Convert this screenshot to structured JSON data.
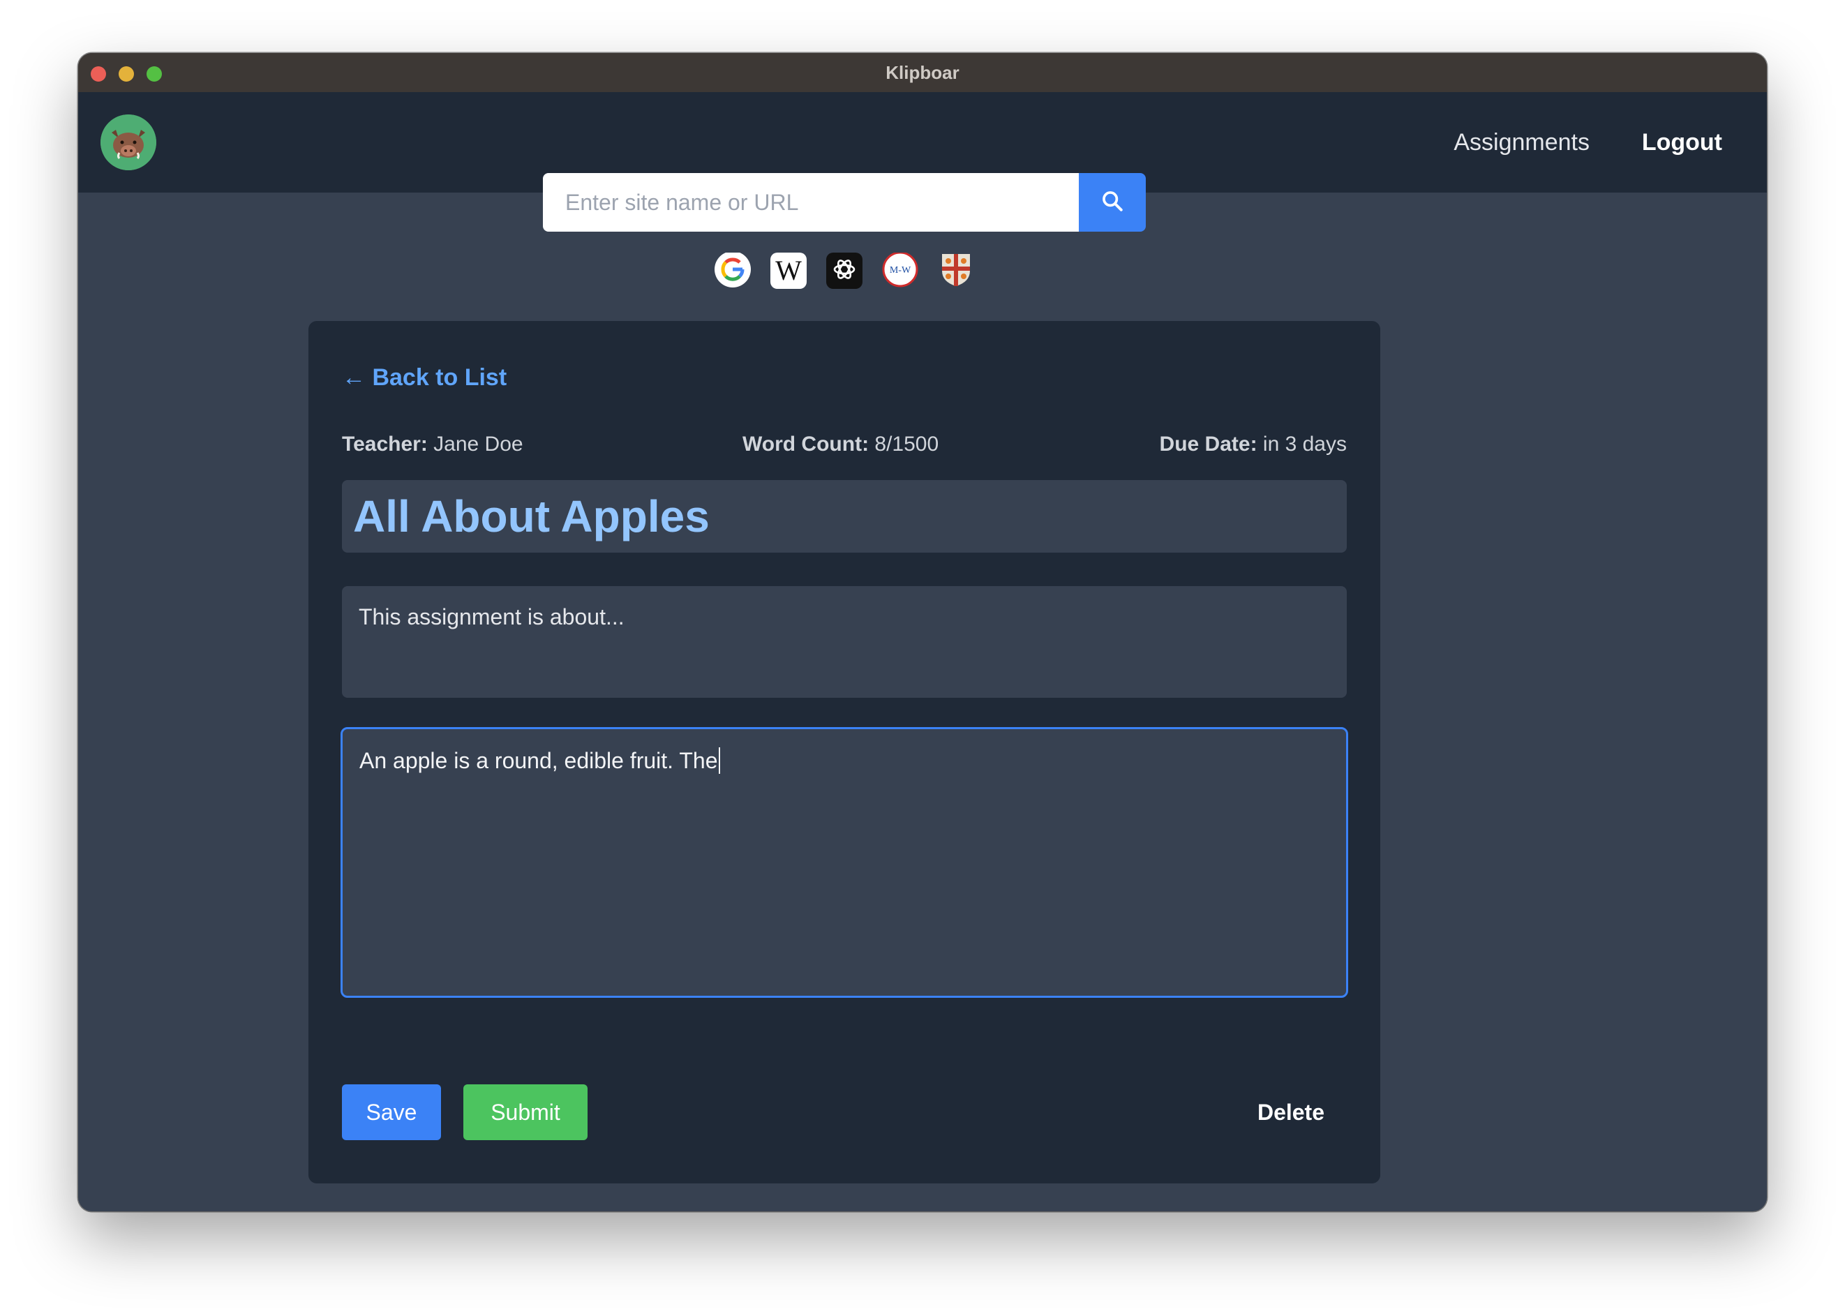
{
  "window": {
    "title": "Klipboar"
  },
  "nav": {
    "logo_icon": "boar-logo-icon",
    "links": [
      {
        "label": "Assignments"
      },
      {
        "label": "Logout"
      }
    ]
  },
  "search": {
    "placeholder": "Enter site name or URL",
    "value": "",
    "button_icon": "search-icon"
  },
  "shortcuts": [
    {
      "name": "Google",
      "icon": "google-icon"
    },
    {
      "name": "Wikipedia",
      "icon": "wikipedia-icon"
    },
    {
      "name": "ChatGPT",
      "icon": "chatgpt-icon"
    },
    {
      "name": "Merriam-Webster",
      "icon": "merriam-webster-icon",
      "text": "M-W"
    },
    {
      "name": "Shield",
      "icon": "shield-icon"
    }
  ],
  "assignment": {
    "back_label": "← Back to List",
    "teacher_label": "Teacher:",
    "teacher": "Jane Doe",
    "word_count_label": "Word Count:",
    "word_count": "8/1500",
    "due_label": "Due Date:",
    "due": "in 3 days",
    "title": "All About Apples",
    "description": "This assignment is about...",
    "essay_text": "An apple is a round, edible fruit. The"
  },
  "actions": {
    "save_label": "Save",
    "submit_label": "Submit",
    "delete_label": "Delete"
  },
  "colors": {
    "accent": "#3b82f6",
    "submit": "#4cc45f",
    "title_text": "#93c5fd",
    "link": "#60a5fa"
  }
}
